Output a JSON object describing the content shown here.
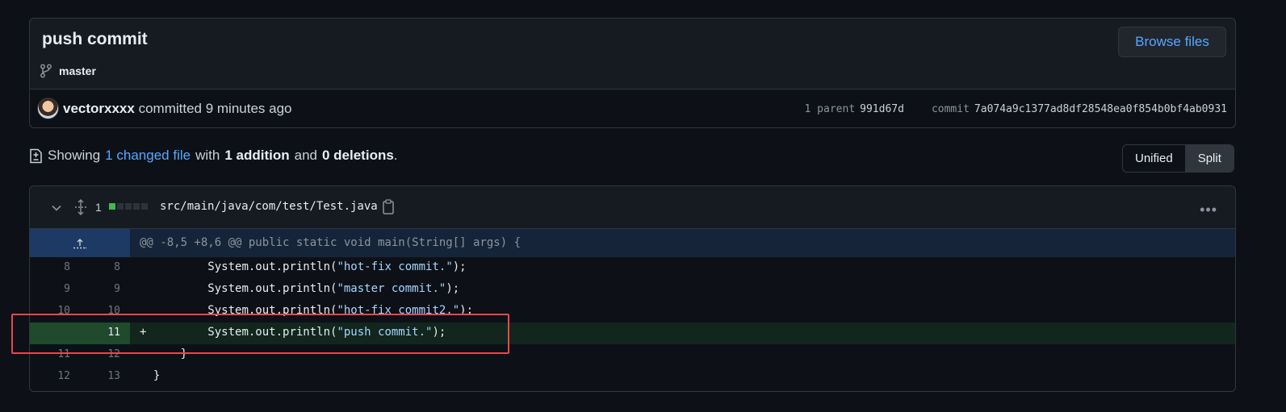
{
  "commit": {
    "title": "push commit",
    "branch": "master",
    "browse_label": "Browse files",
    "author": "vectorxxxx",
    "committed_text": "committed 9 minutes ago",
    "parent_label": "1 parent",
    "parent_sha": "991d67d",
    "commit_label": "commit",
    "commit_sha": "7a074a9c1377ad8df28548ea0f854b0bf4ab0931"
  },
  "summary": {
    "showing": "Showing",
    "changed_files": "1 changed file",
    "with": "with",
    "additions": "1 addition",
    "and": "and",
    "deletions": "0 deletions",
    "period": "."
  },
  "view_toggle": {
    "unified": "Unified",
    "split": "Split"
  },
  "file": {
    "change_count": "1",
    "path": "src/main/java/com/test/Test.java",
    "diffstat": [
      "#3fb950",
      "#2d333b",
      "#2d333b",
      "#2d333b",
      "#2d333b"
    ],
    "hunk_header": "@@ -8,5 +8,6 @@ public static void main(String[] args) {",
    "lines": [
      {
        "old": "8",
        "new": "8",
        "sign": " ",
        "prefix": "        System.out.println(",
        "string": "\"hot-fix commit.\"",
        "suffix": ");",
        "type": "context"
      },
      {
        "old": "9",
        "new": "9",
        "sign": " ",
        "prefix": "        System.out.println(",
        "string": "\"master commit.\"",
        "suffix": ");",
        "type": "context"
      },
      {
        "old": "10",
        "new": "10",
        "sign": " ",
        "prefix": "        System.out.println(",
        "string": "\"hot-fix commit2.\"",
        "suffix": ");",
        "type": "context"
      },
      {
        "old": "",
        "new": "11",
        "sign": "+",
        "prefix": "        System.out.println(",
        "string": "\"push commit.\"",
        "suffix": ");",
        "type": "add"
      },
      {
        "old": "11",
        "new": "12",
        "sign": " ",
        "prefix": "    }",
        "string": "",
        "suffix": "",
        "type": "context"
      },
      {
        "old": "12",
        "new": "13",
        "sign": " ",
        "prefix": "}",
        "string": "",
        "suffix": "",
        "type": "context"
      }
    ]
  },
  "colors": {
    "accent": "#58a6ff",
    "addition": "#3fb950",
    "highlight": "#e5484d"
  }
}
